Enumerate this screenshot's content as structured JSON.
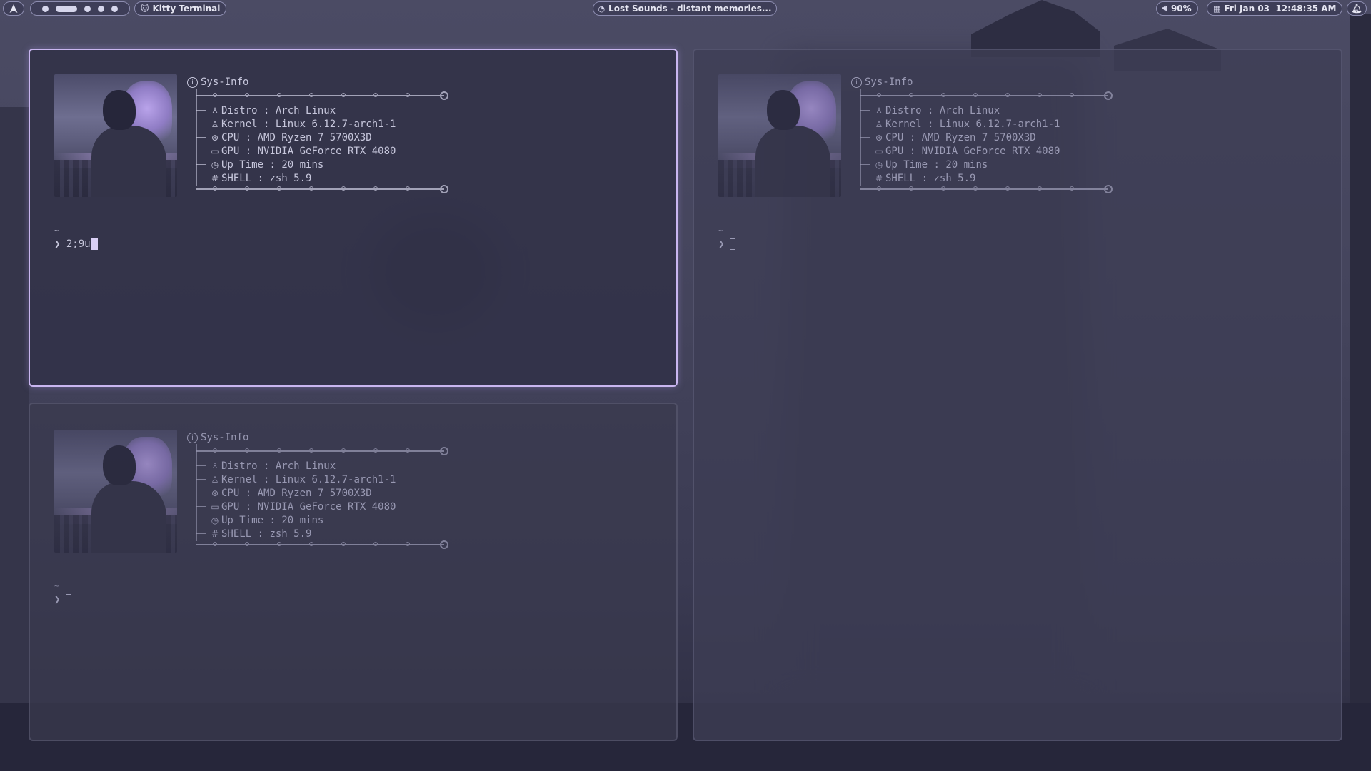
{
  "topbar": {
    "launcher_icon": "arch-logo-icon",
    "workspaces": [
      {
        "state": "occupied"
      },
      {
        "state": "active"
      },
      {
        "state": "occupied"
      },
      {
        "state": "occupied"
      },
      {
        "state": "occupied"
      }
    ],
    "window_title": "Kitty Terminal",
    "window_icon": "cat-icon",
    "media": "Lost Sounds - distant memories...",
    "media_icon": "music-disc-icon",
    "volume": "90%",
    "volume_icon": "speaker-icon",
    "clock": "Fri Jan 03  12:48:35 AM",
    "calendar_icon": "calendar-icon",
    "notification_icon": "bell-icon"
  },
  "terminal": {
    "title": "Sys-Info",
    "rows": [
      {
        "icon": "arch-icon",
        "label": "Distro",
        "sep": " : ",
        "value": "Arch Linux"
      },
      {
        "icon": "tux-icon",
        "label": "Kernel",
        "sep": " : ",
        "value": "Linux 6.12.7-arch1-1"
      },
      {
        "icon": "cpu-icon",
        "label": "CPU",
        "sep": " : ",
        "value": "AMD Ryzen 7 5700X3D"
      },
      {
        "icon": "monitor-icon",
        "label": "GPU",
        "sep": " : ",
        "value": "NVIDIA GeForce RTX 4080"
      },
      {
        "icon": "clock-icon",
        "label": "Up Time",
        "sep": " : ",
        "value": "20 mins"
      },
      {
        "icon": "hash-icon",
        "label": "SHELL",
        "sep": " : ",
        "value": "zsh 5.9"
      }
    ],
    "cwd": "~",
    "prompt_symbol": "❯",
    "active_input": "2;9u"
  },
  "colors": {
    "accent": "#c9b6f0",
    "bar_bg": "#3e3e58",
    "text": "#c7c7dc"
  }
}
